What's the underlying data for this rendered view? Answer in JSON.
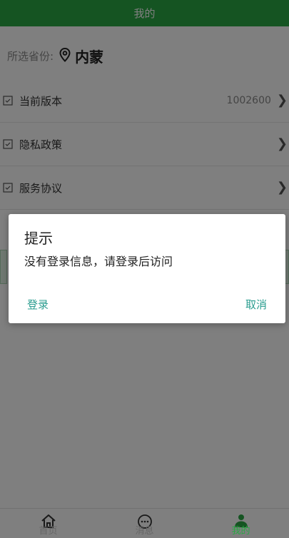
{
  "header": {
    "title": "我的"
  },
  "province": {
    "label": "所选省份:",
    "value": "内蒙",
    "icon": "location-pin-icon"
  },
  "menu": [
    {
      "label": "当前版本",
      "value": "1002600",
      "icon": "checkbox-icon"
    },
    {
      "label": "隐私政策",
      "value": "",
      "icon": "checkbox-icon"
    },
    {
      "label": "服务协议",
      "value": "",
      "icon": "checkbox-icon"
    }
  ],
  "tabbar": {
    "items": [
      {
        "label": "首页",
        "icon": "home-icon"
      },
      {
        "label": "消息",
        "icon": "chat-icon"
      },
      {
        "label": "我的",
        "icon": "user-icon"
      }
    ]
  },
  "dialog": {
    "title": "提示",
    "message": "没有登录信息，请登录后访问",
    "confirm_label": "登录",
    "cancel_label": "取消"
  },
  "colors": {
    "accent": "#2aa845",
    "dialog_button": "#2a9d8f"
  }
}
